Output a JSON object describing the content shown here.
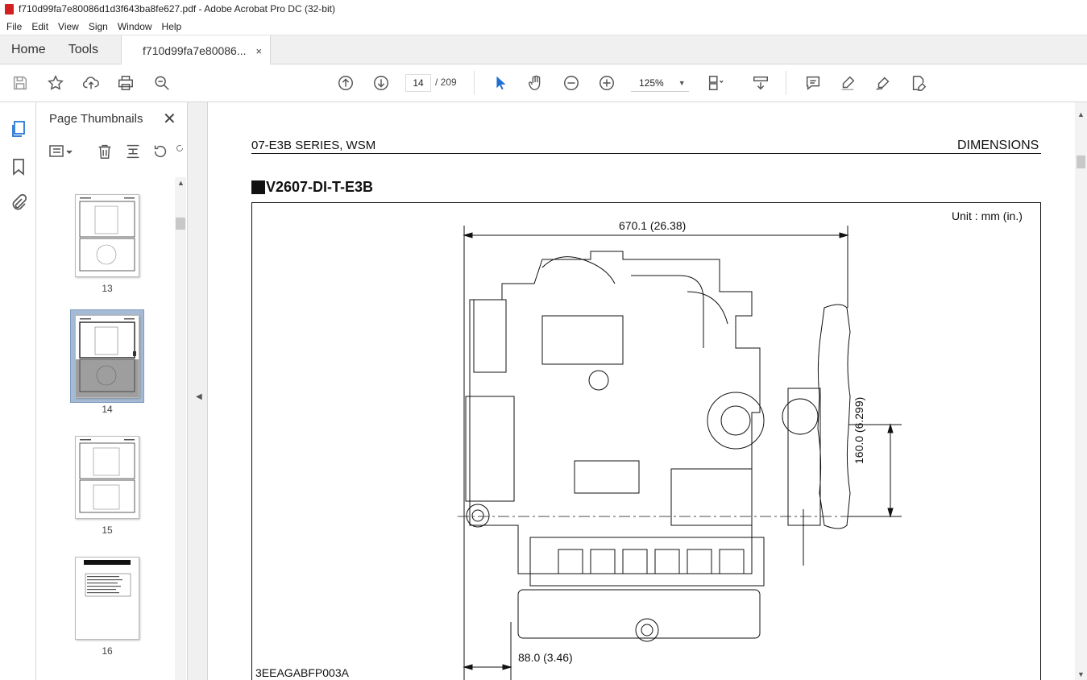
{
  "window": {
    "title": "f710d99fa7e80086d1d3f643ba8fe627.pdf - Adobe Acrobat Pro DC (32-bit)"
  },
  "menu": [
    "File",
    "Edit",
    "View",
    "Sign",
    "Window",
    "Help"
  ],
  "tabs": {
    "home": "Home",
    "tools": "Tools",
    "document": "f710d99fa7e80086...",
    "close": "×"
  },
  "toolbar": {
    "current_page": "14",
    "total_pages": "/ 209",
    "zoom": "125%",
    "icons": [
      "save-icon",
      "star-icon",
      "upload-icon",
      "print-icon",
      "zoom-search-icon",
      "page-up-icon",
      "page-down-icon",
      "select-cursor-icon",
      "hand-icon",
      "zoom-out-icon",
      "zoom-in-icon",
      "page-fit-icon",
      "scroll-mode-icon",
      "comment-icon",
      "highlight-icon",
      "sign-icon",
      "edit-pdf-icon"
    ]
  },
  "panel": {
    "title": "Page Thumbnails",
    "close": "✕",
    "thumbnails": [
      {
        "label": "13",
        "selected": false
      },
      {
        "label": "14",
        "selected": true
      },
      {
        "label": "15",
        "selected": false
      },
      {
        "label": "16",
        "selected": false
      }
    ]
  },
  "document": {
    "header_left": "07-E3B SERIES, WSM",
    "header_right": "DIMENSIONS",
    "section_title": "V2607-DI-T-E3B",
    "unit_label": "Unit : mm (in.)",
    "dim_width": "670.1 (26.38)",
    "dim_height": "160.0 (6.299)",
    "dim_offset": "88.0 (3.46)",
    "figure_code": "3EEAGABFP003A"
  },
  "colors": {
    "accent_red": "#d21f1f",
    "selected_thumb": "#a6bbd3",
    "cursor_blue": "#1f6fd1"
  }
}
